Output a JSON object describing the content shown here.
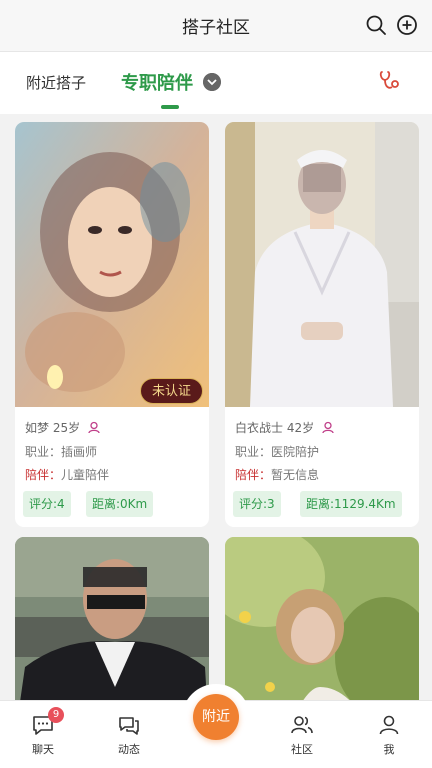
{
  "header": {
    "title": "搭子社区",
    "search_icon": "search-icon",
    "add_icon": "plus-circle-icon"
  },
  "tabs": {
    "nearby": "附近搭子",
    "pro": "专职陪伴",
    "active": "pro",
    "accent_color": "#2e9a4a",
    "filter_icon": "stethoscope-icon"
  },
  "labels": {
    "job": "职业：",
    "companion": "陪伴：",
    "rating": "评分:",
    "distance": "距离:"
  },
  "cards": [
    {
      "name": "如梦",
      "age": "25岁",
      "job": "插画师",
      "companion": "儿童陪伴",
      "rating": "4",
      "distance": "0Km",
      "badge": "未认证"
    },
    {
      "name": "白衣战士",
      "age": "42岁",
      "job": "医院陪护",
      "companion": "暂无信息",
      "rating": "3",
      "distance": "1129.4Km"
    },
    {},
    {}
  ],
  "bottom_nav": {
    "items": [
      {
        "label": "聊天",
        "icon": "chat-icon",
        "badge": "9"
      },
      {
        "label": "动态",
        "icon": "moments-icon"
      },
      {
        "label": "附近",
        "icon": "nearby-fab"
      },
      {
        "label": "社区",
        "icon": "community-icon"
      },
      {
        "label": "我",
        "icon": "user-icon"
      }
    ],
    "fab_color": "#f08030"
  }
}
